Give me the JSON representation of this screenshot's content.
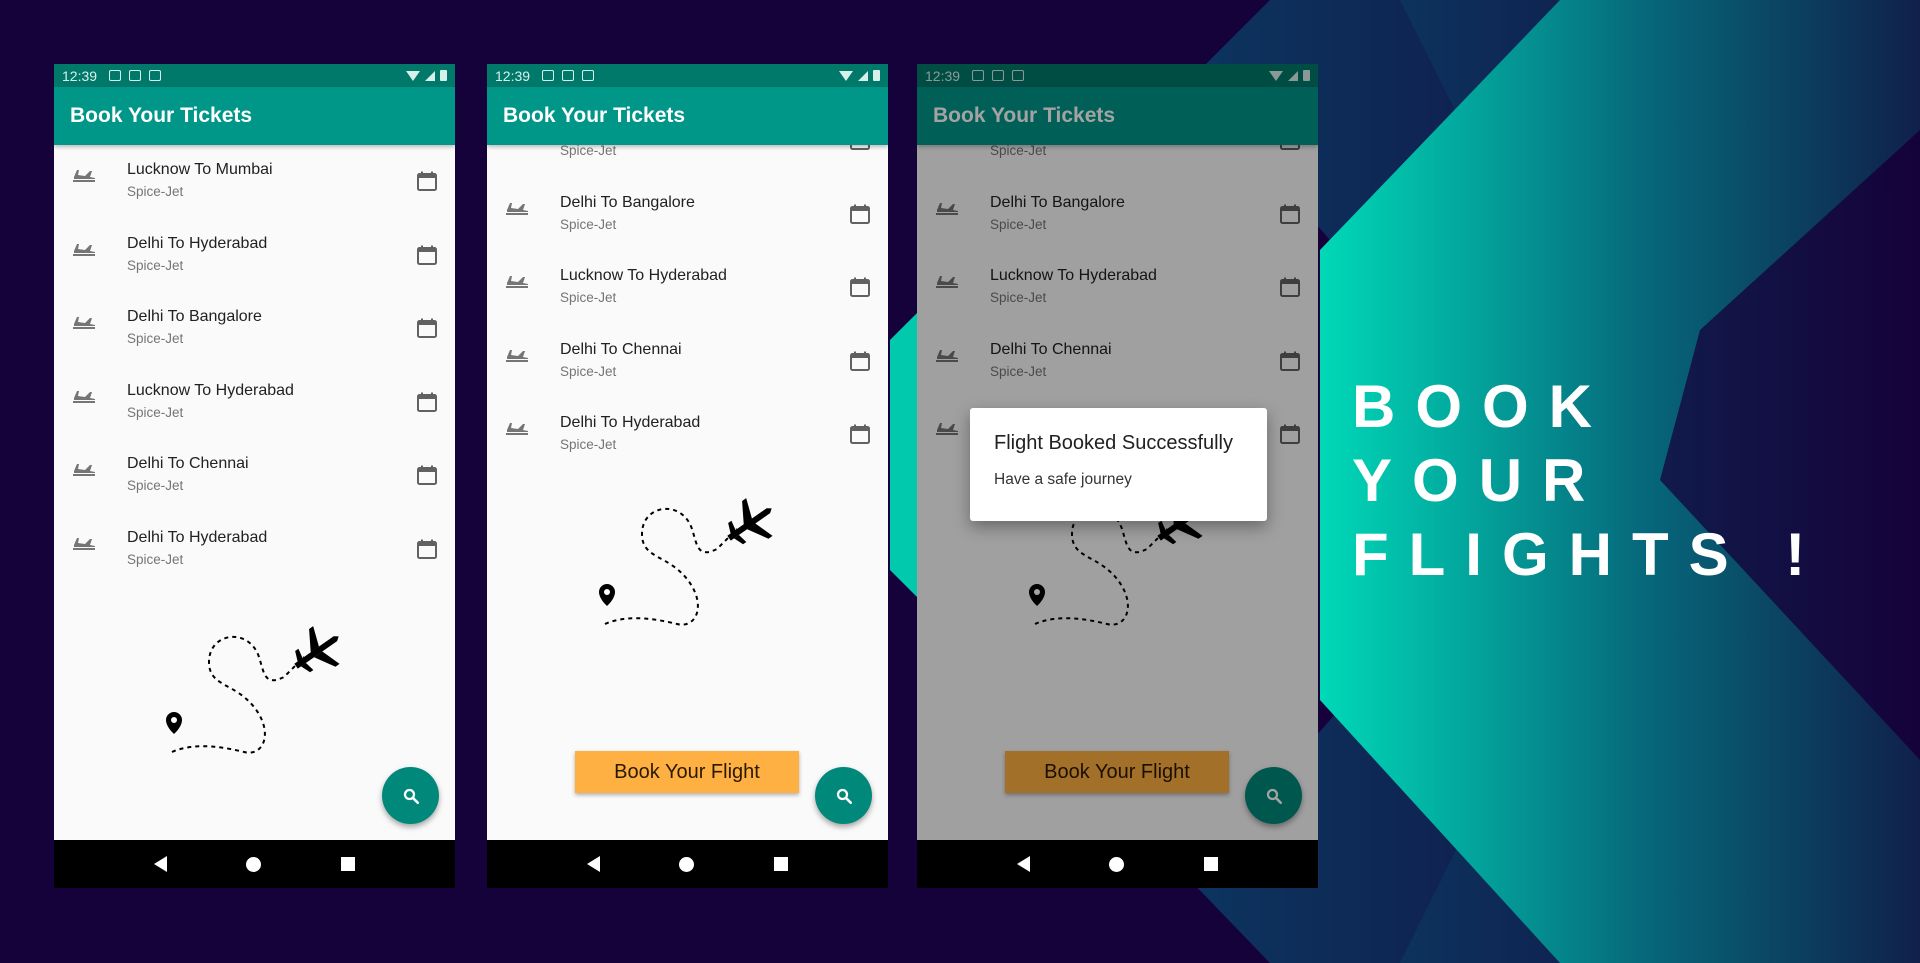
{
  "colors": {
    "background": "#15023a",
    "status_bar": "#00796b",
    "app_bar": "#009688",
    "fab": "#00897b",
    "book_button": "#ffb043",
    "accent_gradient_start": "#00d1b2",
    "accent_gradient_end": "#0a3a5c"
  },
  "phones": [
    {
      "status": {
        "time": "12:39"
      },
      "app_bar": {
        "title": "Book Your Tickets"
      },
      "list": [
        {
          "route": "Lucknow To Mumbai",
          "airline": "Spice-Jet"
        },
        {
          "route": "Delhi To Hyderabad",
          "airline": "Spice-Jet"
        },
        {
          "route": "Delhi To Bangalore",
          "airline": "Spice-Jet"
        },
        {
          "route": "Lucknow To Hyderabad",
          "airline": "Spice-Jet"
        },
        {
          "route": "Delhi To Chennai",
          "airline": "Spice-Jet"
        },
        {
          "route": "Delhi To Hyderabad",
          "airline": "Spice-Jet"
        }
      ],
      "fab_icon": "search-icon"
    },
    {
      "status": {
        "time": "12:39"
      },
      "app_bar": {
        "title": "Book Your Tickets"
      },
      "list": [
        {
          "route": "",
          "airline": "Spice-Jet"
        },
        {
          "route": "Delhi To Bangalore",
          "airline": "Spice-Jet"
        },
        {
          "route": "Lucknow To Hyderabad",
          "airline": "Spice-Jet"
        },
        {
          "route": "Delhi To Chennai",
          "airline": "Spice-Jet"
        },
        {
          "route": "Delhi To Hyderabad",
          "airline": "Spice-Jet"
        }
      ],
      "book_button": "Book Your Flight",
      "fab_icon": "search-icon"
    },
    {
      "status": {
        "time": "12:39"
      },
      "app_bar": {
        "title": "Book Your Tickets"
      },
      "list": [
        {
          "route": "",
          "airline": "Spice-Jet"
        },
        {
          "route": "Delhi To Bangalore",
          "airline": "Spice-Jet"
        },
        {
          "route": "Lucknow To Hyderabad",
          "airline": "Spice-Jet"
        },
        {
          "route": "Delhi To Chennai",
          "airline": "Spice-Jet"
        },
        {
          "route": "",
          "airline": ""
        }
      ],
      "book_button": "Book Your Flight",
      "fab_icon": "search-icon",
      "dialog": {
        "title": "Flight Booked Successfully",
        "message": "Have a safe journey"
      }
    }
  ],
  "tagline": [
    "BOOK",
    "YOUR",
    "FLIGHTS !"
  ]
}
